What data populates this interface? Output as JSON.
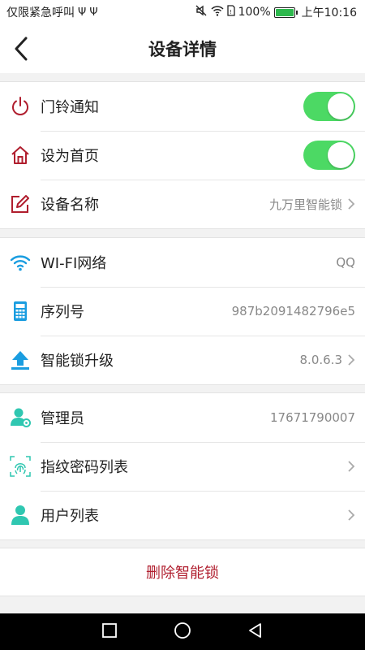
{
  "status_bar": {
    "carrier": "仅限紧急呼叫",
    "battery": "100%",
    "time": "上午10:16"
  },
  "header": {
    "title": "设备详情"
  },
  "groups": [
    {
      "items": [
        {
          "label": "门铃通知",
          "toggle": true,
          "icon": "power-icon"
        },
        {
          "label": "设为首页",
          "toggle": true,
          "icon": "home-icon"
        },
        {
          "label": "设备名称",
          "value": "九万里智能锁",
          "icon": "edit-icon"
        }
      ]
    },
    {
      "items": [
        {
          "label": "WI-FI网络",
          "value": "QQ",
          "icon": "wifi-icon"
        },
        {
          "label": "序列号",
          "value": "987b2091482796e5",
          "icon": "serial-icon"
        },
        {
          "label": "智能锁升级",
          "value": "8.0.6.3",
          "icon": "upgrade-icon"
        }
      ]
    },
    {
      "items": [
        {
          "label": "管理员",
          "value": "17671790007",
          "icon": "admin-icon"
        },
        {
          "label": "指纹密码列表",
          "value": "",
          "icon": "fingerprint-icon"
        },
        {
          "label": "用户列表",
          "value": "",
          "icon": "user-icon"
        }
      ]
    }
  ],
  "actions": {
    "delete_label": "删除智能锁"
  },
  "colors": {
    "toggle_on": "#4cd964",
    "danger": "#b01e2e",
    "icon_red": "#b01e2e",
    "icon_blue": "#1a9de0",
    "icon_teal": "#2fc7b1"
  }
}
